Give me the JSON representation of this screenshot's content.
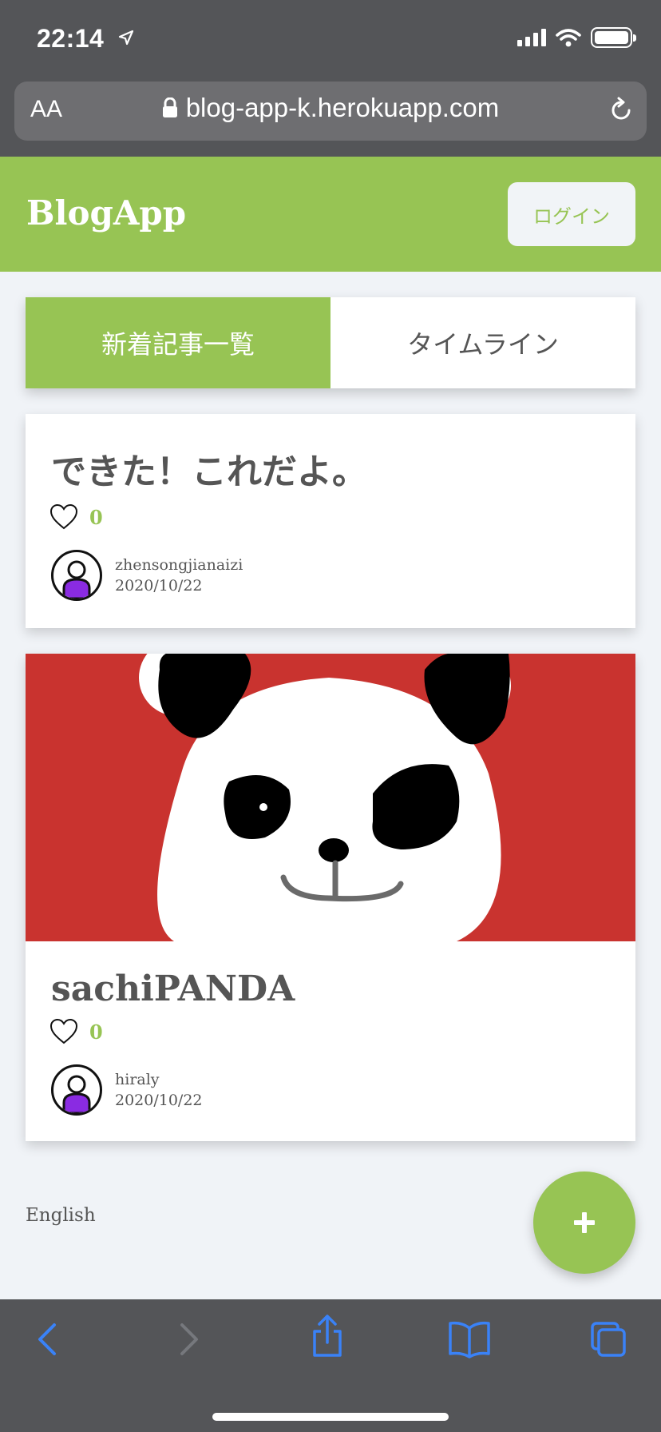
{
  "status_bar": {
    "time": "22:14"
  },
  "browser": {
    "text_size_label": "AA",
    "url": "blog-app-k.herokuapp.com"
  },
  "header": {
    "brand": "BlogApp",
    "login_label": "ログイン"
  },
  "tabs": [
    {
      "label": "新着記事一覧",
      "active": true
    },
    {
      "label": "タイムライン",
      "active": false
    }
  ],
  "posts": [
    {
      "title": "できた！これだよ。",
      "likes": "0",
      "author": "zhensongjianaizi",
      "date": "2020/10/22",
      "has_image": false
    },
    {
      "title": "sachiPANDA",
      "likes": "0",
      "author": "hiraly",
      "date": "2020/10/22",
      "has_image": true
    }
  ],
  "footer": {
    "language_label": "English"
  },
  "colors": {
    "accent": "#97c454",
    "page_bg": "#f0f3f7",
    "ios_chrome": "#545558",
    "ios_blue": "#3a82f7",
    "panda_bg": "#c9332f"
  },
  "icons": [
    "location-arrow-icon",
    "signal-icon",
    "wifi-icon",
    "battery-icon",
    "lock-icon",
    "reload-icon",
    "heart-icon",
    "avatar-icon",
    "plus-icon",
    "back-icon",
    "forward-icon",
    "share-icon",
    "bookmarks-icon",
    "tabs-icon"
  ]
}
